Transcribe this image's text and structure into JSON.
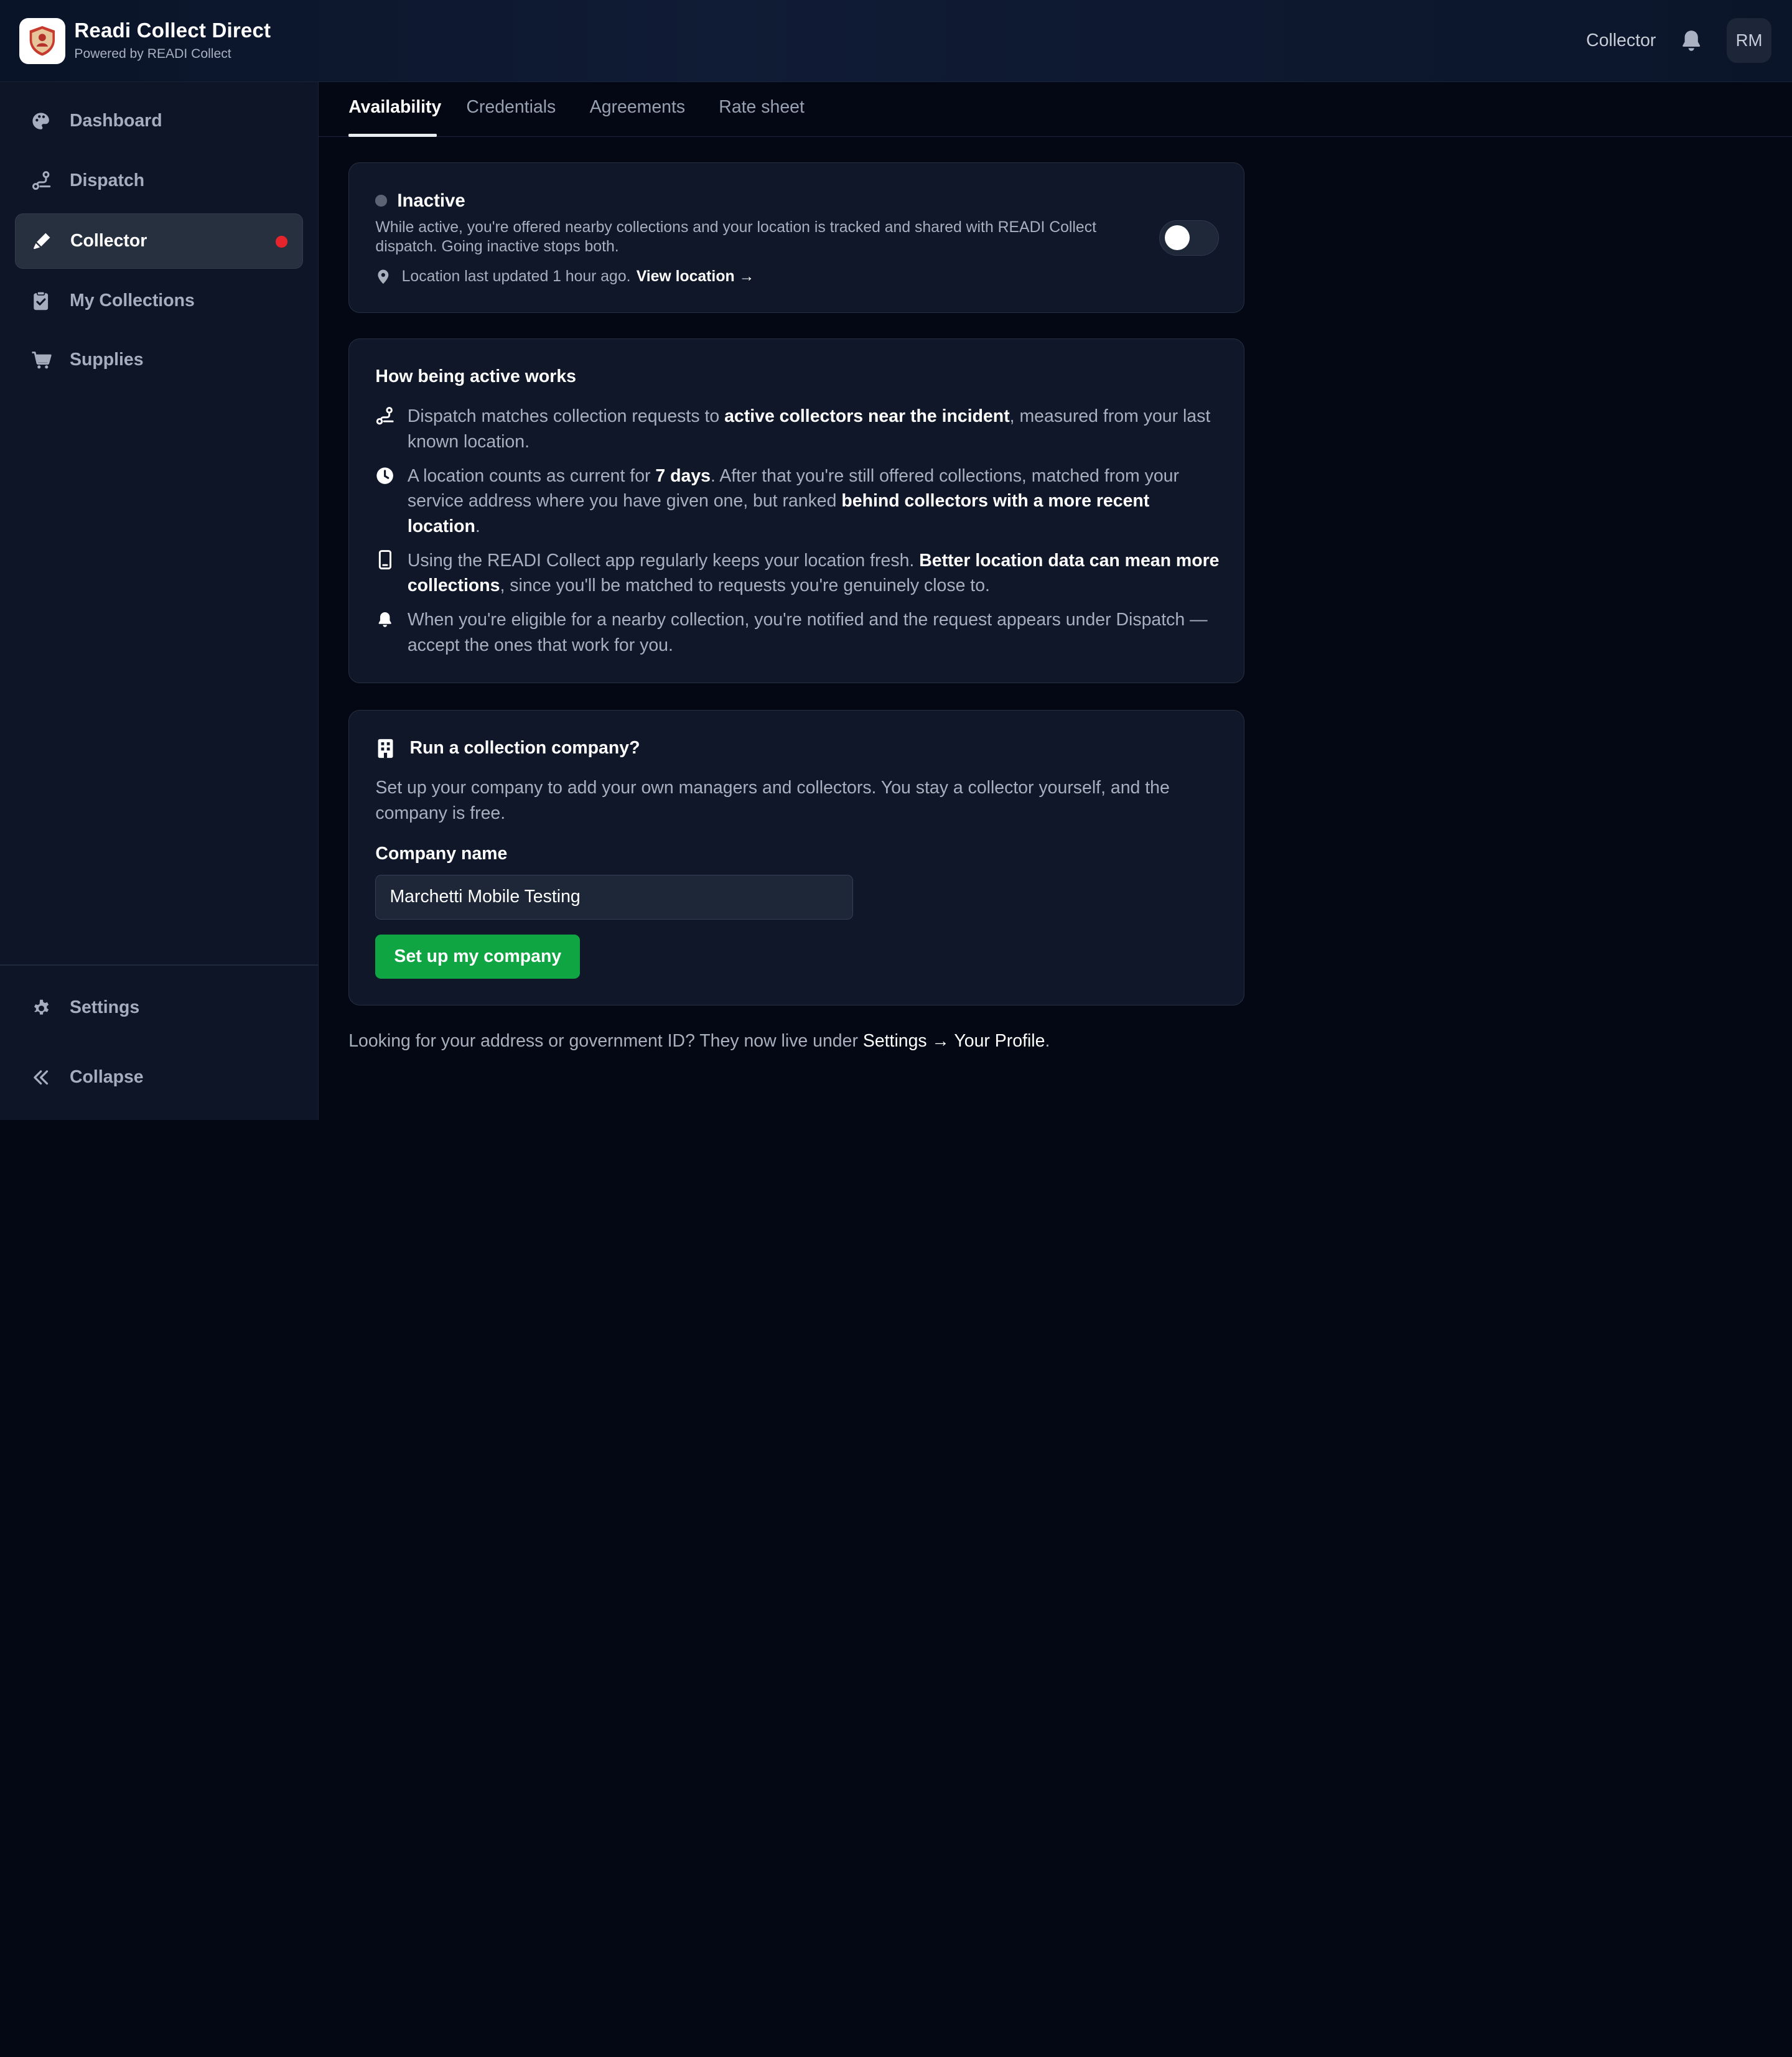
{
  "header": {
    "brand_title": "Readi Collect Direct",
    "brand_subtitle": "Powered by READI Collect",
    "role_label": "Collector",
    "avatar_initials": "RM"
  },
  "sidebar": {
    "items": [
      {
        "label": "Dashboard",
        "icon": "palette-icon"
      },
      {
        "label": "Dispatch",
        "icon": "route-icon"
      },
      {
        "label": "Collector",
        "icon": "pen-icon",
        "active": true,
        "notification_dot": true
      },
      {
        "label": "My Collections",
        "icon": "clipboard-check-icon"
      },
      {
        "label": "Supplies",
        "icon": "cart-icon"
      }
    ],
    "bottom": {
      "settings_label": "Settings",
      "collapse_label": "Collapse"
    }
  },
  "tabs": [
    "Availability",
    "Credentials",
    "Agreements",
    "Rate sheet"
  ],
  "active_tab": "Availability",
  "status_card": {
    "title": "Inactive",
    "description": "While active, you're offered nearby collections and your location is tracked and shared with READI Collect dispatch. Going inactive stops both.",
    "location_text": "Location last updated 1 hour ago.",
    "view_location": "View location →",
    "toggle_on": false
  },
  "how_card": {
    "title": "How being active works",
    "items": [
      {
        "icon": "route-icon",
        "parts": [
          {
            "t": "Dispatch matches collection requests to "
          },
          {
            "t": "active collectors near the incident",
            "b": true
          },
          {
            "t": ", measured from your last known location."
          }
        ]
      },
      {
        "icon": "clock-icon",
        "parts": [
          {
            "t": "A location counts as current for "
          },
          {
            "t": "7 days",
            "b": true
          },
          {
            "t": ". After that you're still offered collections, matched from your service address where you have given one, but ranked "
          },
          {
            "t": "behind collectors with a more recent location",
            "b": true
          },
          {
            "t": "."
          }
        ]
      },
      {
        "icon": "phone-icon",
        "parts": [
          {
            "t": "Using the READI Collect app regularly keeps your location fresh. "
          },
          {
            "t": "Better location data can mean more collections",
            "b": true
          },
          {
            "t": ", since you'll be matched to requests you're genuinely close to."
          }
        ]
      },
      {
        "icon": "bell-icon",
        "parts": [
          {
            "t": "When you're eligible for a nearby collection, you're notified and the request appears under Dispatch — accept the ones that work for you."
          }
        ]
      }
    ]
  },
  "company_card": {
    "title": "Run a collection company?",
    "description": "Set up your company to add your own managers and collectors. You stay a collector yourself, and the company is free.",
    "field_label": "Company name",
    "field_value": "Marchetti Mobile Testing",
    "button_label": "Set up my company"
  },
  "footer_note": {
    "text": "Looking for your address or government ID? They now live under ",
    "link": "Settings → Your Profile",
    "suffix": "."
  },
  "colors": {
    "accent_green": "#0fa543",
    "notification_red": "#e5252b",
    "background": "#030814"
  }
}
